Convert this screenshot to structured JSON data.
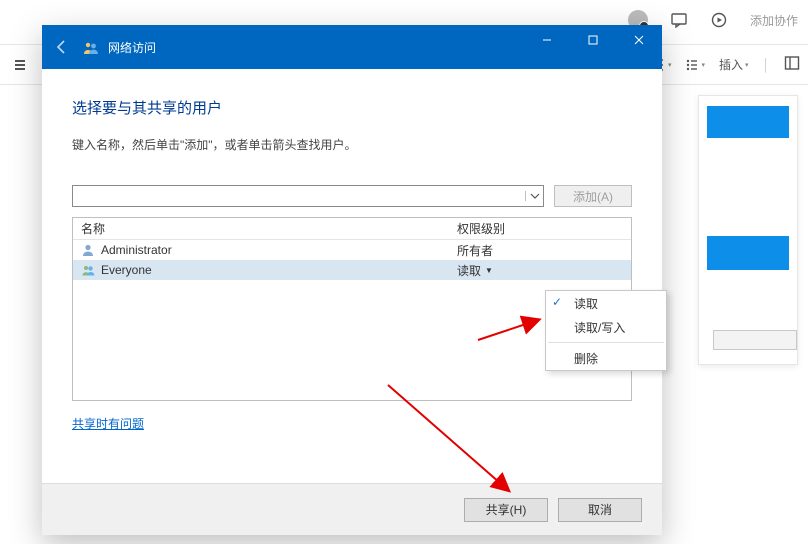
{
  "backgroundApp": {
    "topRightText": "添加协作",
    "toolbar": {
      "insertLabel": "插入"
    }
  },
  "dialog": {
    "title": "网络访问",
    "heading": "选择要与其共享的用户",
    "instruction": "键入名称，然后单击\"添加\"，或者单击箭头查找用户。",
    "comboValue": "",
    "addButton": "添加(A)",
    "table": {
      "headers": {
        "name": "名称",
        "permission": "权限级别"
      },
      "rows": [
        {
          "icon": "user-icon",
          "name": "Administrator",
          "permission": "所有者",
          "hasDropdown": false,
          "selected": false
        },
        {
          "icon": "group-icon",
          "name": "Everyone",
          "permission": "读取",
          "hasDropdown": true,
          "selected": true
        }
      ]
    },
    "helpLink": "共享时有问题",
    "footer": {
      "share": "共享(H)",
      "cancel": "取消"
    }
  },
  "contextMenu": {
    "items": [
      {
        "label": "读取",
        "checked": true
      },
      {
        "label": "读取/写入",
        "checked": false
      }
    ],
    "separatorAfter": 1,
    "lastItem": {
      "label": "删除",
      "checked": false
    }
  }
}
